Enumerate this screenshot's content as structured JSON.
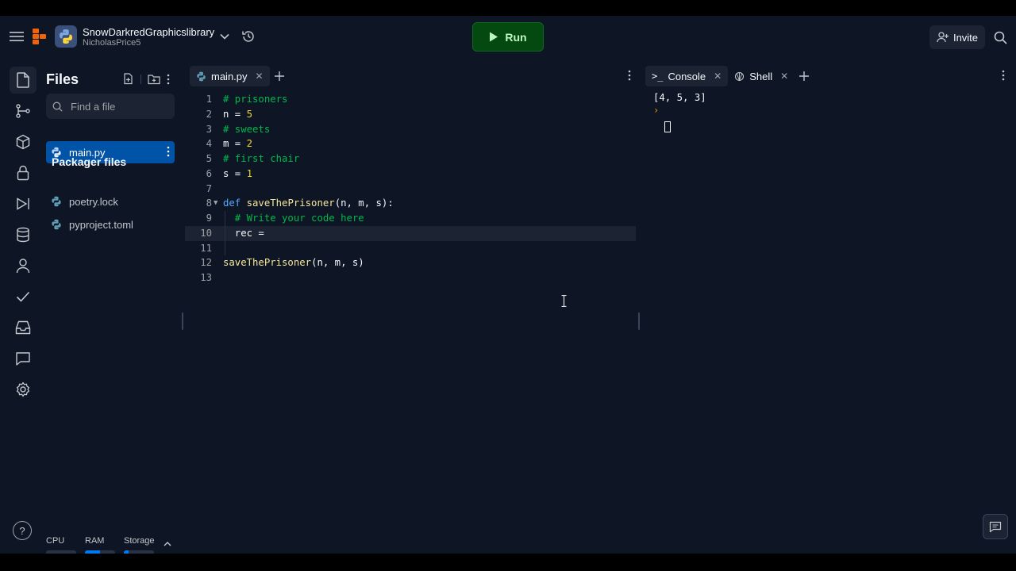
{
  "header": {
    "repl_title": "SnowDarkredGraphicslibrary",
    "repl_owner": "NicholasPrice5",
    "run_label": "Run",
    "invite_label": "Invite"
  },
  "rail": {
    "icons": [
      "files-icon",
      "git-icon",
      "packages-icon",
      "secrets-icon",
      "debugger-icon",
      "database-icon",
      "auth-icon",
      "checks-icon",
      "inbox-icon",
      "chat-icon",
      "settings-icon"
    ]
  },
  "files": {
    "title": "Files",
    "search_placeholder": "Find a file",
    "items": [
      {
        "name": "main.py",
        "active": true
      }
    ],
    "packager_title": "Packager files",
    "packager_items": [
      {
        "name": "poetry.lock"
      },
      {
        "name": "pyproject.toml"
      }
    ],
    "resources": {
      "cpu_label": "CPU",
      "ram_label": "RAM",
      "storage_label": "Storage",
      "cpu": 0.0,
      "ram": 0.5,
      "storage": 0.15
    },
    "help_label": "?"
  },
  "editor": {
    "tab_label": "main.py",
    "current_line": 10,
    "lines": [
      {
        "n": "1",
        "parts": [
          {
            "t": "# prisoners",
            "c": "cmt"
          }
        ]
      },
      {
        "n": "2",
        "parts": [
          {
            "t": "n = ",
            "c": ""
          },
          {
            "t": "5",
            "c": "num"
          }
        ]
      },
      {
        "n": "3",
        "parts": [
          {
            "t": "# sweets",
            "c": "cmt"
          }
        ]
      },
      {
        "n": "4",
        "parts": [
          {
            "t": "m = ",
            "c": ""
          },
          {
            "t": "2",
            "c": "num"
          }
        ]
      },
      {
        "n": "5",
        "parts": [
          {
            "t": "# first chair",
            "c": "cmt"
          }
        ]
      },
      {
        "n": "6",
        "parts": [
          {
            "t": "s = ",
            "c": ""
          },
          {
            "t": "1",
            "c": "num"
          }
        ]
      },
      {
        "n": "7",
        "parts": []
      },
      {
        "n": "8",
        "fold": true,
        "parts": [
          {
            "t": "def ",
            "c": "kw"
          },
          {
            "t": "saveThePrisoner",
            "c": "fn"
          },
          {
            "t": "(n, m, s):",
            "c": ""
          }
        ]
      },
      {
        "n": "9",
        "guide": true,
        "parts": [
          {
            "t": "  # Write your code here",
            "c": "cmt"
          }
        ]
      },
      {
        "n": "10",
        "guide": true,
        "parts": [
          {
            "t": "  rec = ",
            "c": ""
          }
        ]
      },
      {
        "n": "11",
        "guide": true,
        "parts": []
      },
      {
        "n": "12",
        "parts": [
          {
            "t": "saveThePrisoner",
            "c": "fn"
          },
          {
            "t": "(n, m, s)",
            "c": ""
          }
        ]
      },
      {
        "n": "13",
        "parts": []
      }
    ]
  },
  "console": {
    "tab_console": "Console",
    "tab_shell": "Shell",
    "output": "[4, 5, 3]",
    "prompt": "›"
  }
}
